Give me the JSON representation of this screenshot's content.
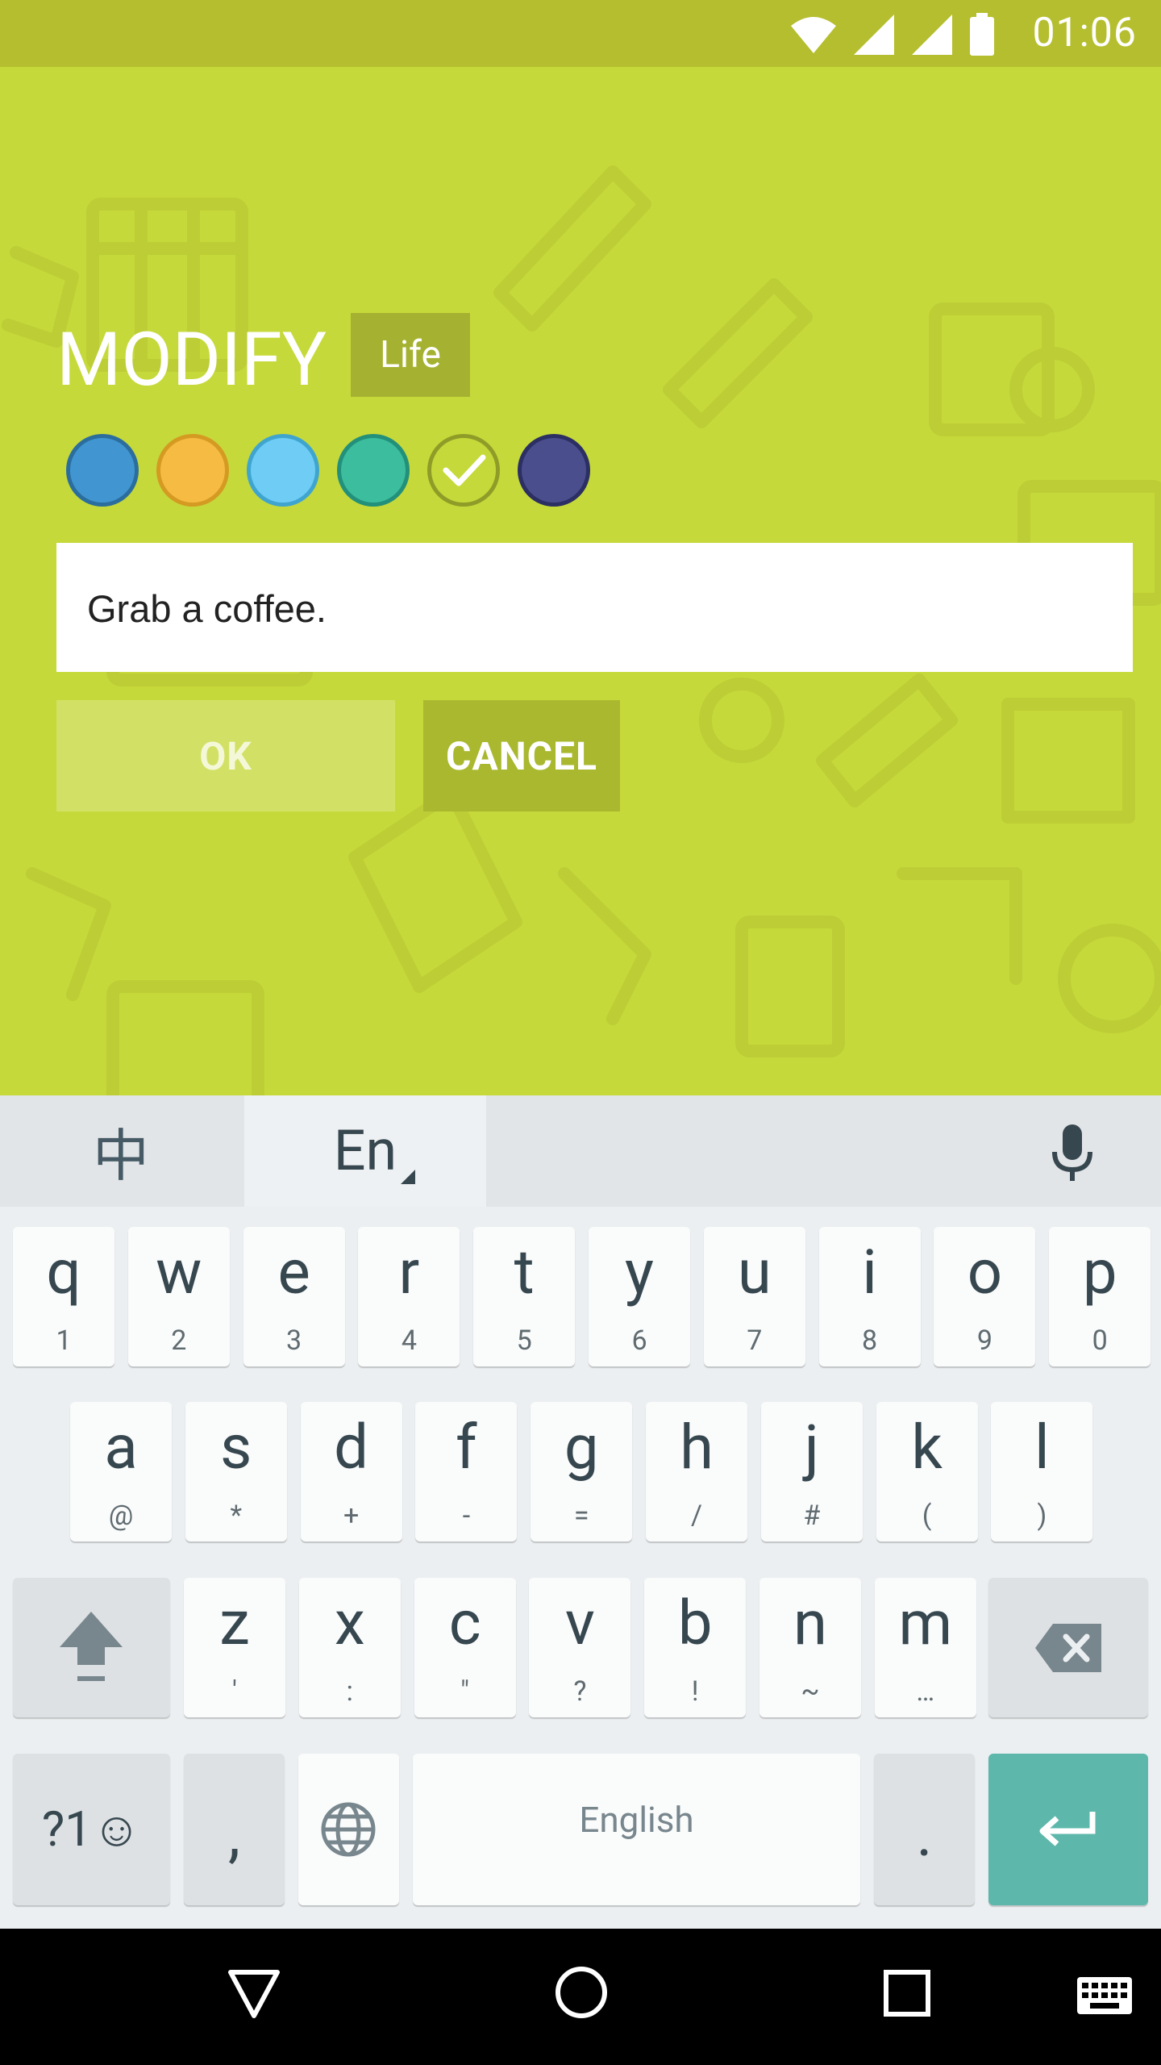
{
  "status_bar": {
    "time": "01:06"
  },
  "dialog": {
    "title": "MODIFY",
    "category_label": "Life",
    "color_choices": [
      {
        "name": "blue",
        "fill": "#4196d2",
        "border": "#2b6e9e"
      },
      {
        "name": "orange",
        "fill": "#f6bb42",
        "border": "#d49a22"
      },
      {
        "name": "light-blue",
        "fill": "#6fcdf5",
        "border": "#3fa5cf"
      },
      {
        "name": "teal",
        "fill": "#3bbd9e",
        "border": "#22907a"
      },
      {
        "name": "lime",
        "fill": "#c6d93a",
        "border": "#8f9c28",
        "selected": true
      },
      {
        "name": "indigo",
        "fill": "#4a4e8c",
        "border": "#2c2f63"
      }
    ],
    "note_value": "Grab a coffee.",
    "ok_label": "OK",
    "cancel_label": "CANCEL"
  },
  "keyboard": {
    "lang_tab_cn": "中",
    "lang_tab_en": "En",
    "row1": [
      {
        "k": "q",
        "s": "1"
      },
      {
        "k": "w",
        "s": "2"
      },
      {
        "k": "e",
        "s": "3"
      },
      {
        "k": "r",
        "s": "4"
      },
      {
        "k": "t",
        "s": "5"
      },
      {
        "k": "y",
        "s": "6"
      },
      {
        "k": "u",
        "s": "7"
      },
      {
        "k": "i",
        "s": "8"
      },
      {
        "k": "o",
        "s": "9"
      },
      {
        "k": "p",
        "s": "0"
      }
    ],
    "row2": [
      {
        "k": "a",
        "s": "@"
      },
      {
        "k": "s",
        "s": "*"
      },
      {
        "k": "d",
        "s": "+"
      },
      {
        "k": "f",
        "s": "-"
      },
      {
        "k": "g",
        "s": "="
      },
      {
        "k": "h",
        "s": "/"
      },
      {
        "k": "j",
        "s": "#"
      },
      {
        "k": "k",
        "s": "("
      },
      {
        "k": "l",
        "s": ")"
      }
    ],
    "row3": [
      {
        "k": "z",
        "s": "'"
      },
      {
        "k": "x",
        "s": ":"
      },
      {
        "k": "c",
        "s": "\""
      },
      {
        "k": "v",
        "s": "?"
      },
      {
        "k": "b",
        "s": "!"
      },
      {
        "k": "n",
        "s": "~"
      },
      {
        "k": "m",
        "s": "…"
      }
    ],
    "symbols_label": "?1☺",
    "comma_label": ",",
    "space_label": "English",
    "period_label": "."
  },
  "colors": {
    "app_background": "#c6d93a",
    "status_bar": "#b5be2e",
    "enter_key": "#5db8ab"
  }
}
